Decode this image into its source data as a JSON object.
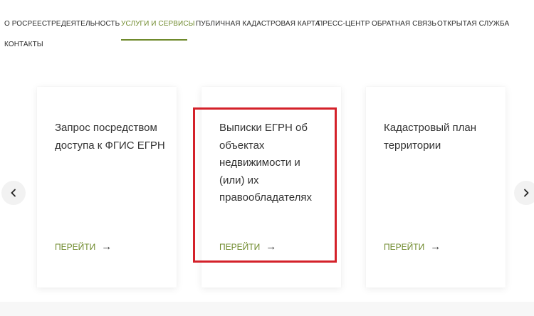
{
  "nav": {
    "items": [
      {
        "label": "О РОСРЕЕСТРЕ"
      },
      {
        "label": "ДЕЯТЕЛЬНОСТЬ"
      },
      {
        "label": "УСЛУГИ И СЕРВИСЫ"
      },
      {
        "label": "ПУБЛИЧНАЯ КАДАСТРОВАЯ КАРТА"
      },
      {
        "label": "ПРЕСС-ЦЕНТР"
      },
      {
        "label": "ОБРАТНАЯ СВЯЗЬ"
      },
      {
        "label": "ОТКРЫТАЯ СЛУЖБА"
      },
      {
        "label": "КОНТАКТЫ"
      }
    ],
    "active_index": 2
  },
  "cards": [
    {
      "title": "Запрос посредством доступа к ФГИС ЕГРН",
      "link_label": "ПЕРЕЙТИ",
      "link_arrow": "→"
    },
    {
      "title": "Выписки ЕГРН об объектах недвижимости и (или) их правообладателях",
      "link_label": "ПЕРЕЙТИ",
      "link_arrow": "→"
    },
    {
      "title": "Кадастровый план территории",
      "link_label": "ПЕРЕЙТИ",
      "link_arrow": "→"
    }
  ],
  "carousel": {
    "prev_icon": "chevron-left-icon",
    "next_icon": "chevron-right-icon"
  },
  "colors": {
    "accent": "#6f8a2c",
    "highlight": "#d4212a",
    "text": "#333333"
  }
}
